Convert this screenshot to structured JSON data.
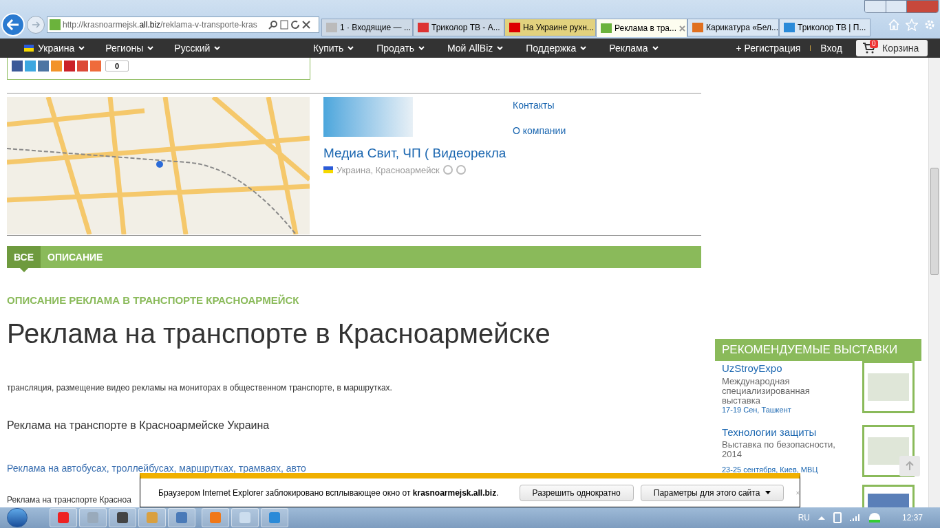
{
  "browser": {
    "address": {
      "prefix": "http://krasnoarmejsk.",
      "domain": "all.biz",
      "rest": "/reklama-v-transporte-kras"
    },
    "tabs": [
      {
        "label": "1 · Входящие — ...",
        "selected": false,
        "color": "#cdd9e6"
      },
      {
        "label": "Триколор ТВ - А...",
        "selected": false,
        "color": "#cdd9e6"
      },
      {
        "label": "На Украине рухн...",
        "selected": false,
        "color": "#e2d27e"
      },
      {
        "label": "Реклама в тра...",
        "selected": true,
        "color": "#fdfdf0"
      },
      {
        "label": "Карикатура «Бел...",
        "selected": false,
        "color": "#d9e6f3"
      },
      {
        "label": "Триколор ТВ | П...",
        "selected": false,
        "color": "#d9e6f3"
      }
    ]
  },
  "site_nav": {
    "left": [
      "Украина",
      "Регионы",
      "Русский"
    ],
    "menu": [
      "Купить",
      "Продать",
      "Мой AllBiz",
      "Поддержка",
      "Реклама"
    ],
    "register": "+ Регистрация",
    "login": "Вход",
    "cart": {
      "count": "0",
      "label": "Корзина"
    }
  },
  "share": {
    "count": "0"
  },
  "company": {
    "name": "Медиа Свит, ЧП ( Видеорекла",
    "location": "Украина, Красноармейск",
    "links": [
      "Контакты",
      "О компании"
    ]
  },
  "page_tabs": [
    {
      "label": "ВСЕ",
      "selected": true
    },
    {
      "label": "ОПИСАНИЕ",
      "selected": false
    }
  ],
  "section_heading": "ОПИСАНИЕ РЕКЛАМА В ТРАНСПОРТЕ КРАСНОАРМЕЙСК",
  "title": "Реклама на транспорте в Красноармейске",
  "intro": "трансляция, размещение видео рекламы на мониторах в общественном транспорте, в маршрутках.",
  "subheading": "Реклама на транспорте в Красноармейске Украина",
  "link": "Реклама на автобусах, троллейбусах, маршрутках, трамваях, авто",
  "paragraph": "Реклама на транспорте Красноа",
  "exhibitions": {
    "title": "РЕКОМЕНДУЕМЫЕ ВЫСТАВКИ",
    "items": [
      {
        "kind": "full",
        "title": "UzStroyExpo",
        "description": "Международная специализированная выставка",
        "date": "17-19 Сен, Ташкент"
      },
      {
        "kind": "full",
        "title": "Технологии защиты",
        "description": "Выставка по безопасности, 2014",
        "date": "23-25 сентября, Киев, МВЦ"
      },
      {
        "kind": "thumbnail"
      }
    ]
  },
  "popup_bar": {
    "message": "Браузером Internet Explorer заблокировано всплывающее окно от **krasnoarmejsk.all.biz**.",
    "buttons": [
      "Разрешить однократно",
      "Параметры для этого сайта"
    ]
  },
  "taskbar": {
    "language": "RU",
    "time": "12:37"
  }
}
